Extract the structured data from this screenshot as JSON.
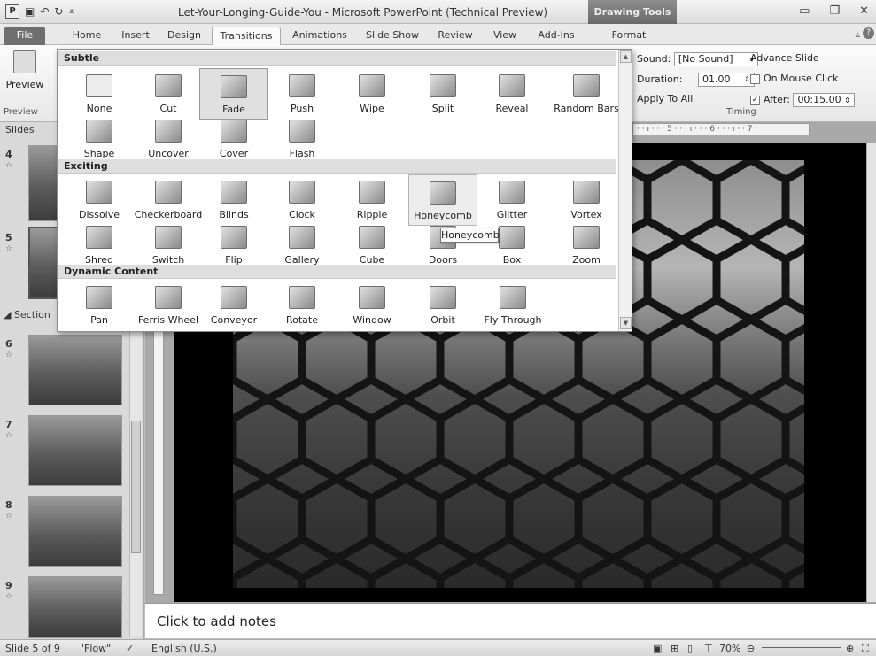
{
  "title_bar": {
    "title": "Let-Your-Longing-Guide-You - Microsoft PowerPoint (Technical Preview)",
    "context_tab": "Drawing Tools"
  },
  "tabs": [
    "File",
    "Home",
    "Insert",
    "Design",
    "Transitions",
    "Animations",
    "Slide Show",
    "Review",
    "View",
    "Add-Ins",
    "Format"
  ],
  "ribbon": {
    "preview_label": "Preview",
    "preview_group": "Preview",
    "sound_label": "Sound:",
    "sound_value": "[No Sound]",
    "duration_label": "Duration:",
    "duration_value": "01.00",
    "apply_all": "Apply To All",
    "advance_title": "Advance Slide",
    "on_mouse_click": "On Mouse Click",
    "after_label": "After:",
    "after_value": "00:15.00",
    "timing_group": "Timing"
  },
  "slides_panel": {
    "tab_label": "Slides",
    "section_label": "Section",
    "numbers": [
      "4",
      "5",
      "6",
      "7",
      "8",
      "9"
    ]
  },
  "gallery": {
    "sections": [
      "Subtle",
      "Exciting",
      "Dynamic Content"
    ],
    "subtle": [
      "None",
      "Cut",
      "Fade",
      "Push",
      "Wipe",
      "Split",
      "Reveal",
      "Random Bars",
      "Shape",
      "Uncover",
      "Cover",
      "Flash"
    ],
    "exciting": [
      "Dissolve",
      "Checkerboard",
      "Blinds",
      "Clock",
      "Ripple",
      "Honeycomb",
      "Glitter",
      "Vortex",
      "Shred",
      "Switch",
      "Flip",
      "Gallery",
      "Cube",
      "Doors",
      "Box",
      "Zoom"
    ],
    "dynamic": [
      "Pan",
      "Ferris Wheel",
      "Conveyor",
      "Rotate",
      "Window",
      "Orbit",
      "Fly Through"
    ],
    "tooltip": "Honeycomb"
  },
  "ruler_text": "· · ı · · · 5 · · · ı · · · 6 · · · ı · · 7 ·",
  "notes_placeholder": "Click to add notes",
  "status": {
    "slide_info": "Slide 5 of 9",
    "theme": "\"Flow\"",
    "language": "English (U.S.)",
    "zoom": "70%"
  }
}
